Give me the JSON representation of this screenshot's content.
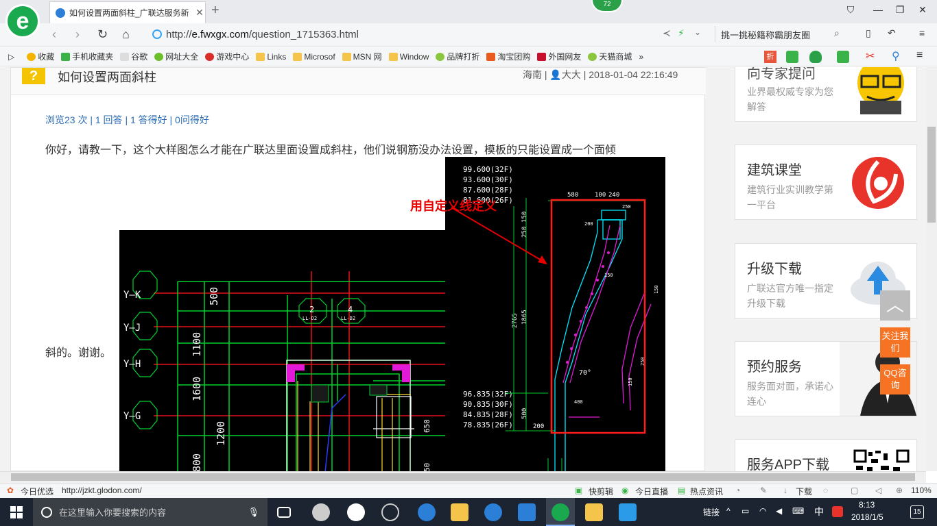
{
  "browser": {
    "tab_title": "如何设置两面斜柱_广联达服务新",
    "badge": "72",
    "url_scheme": "http://",
    "url_domain": "e.fwxgx.com",
    "url_path": "/question_1715363.html",
    "search_text": "挑一挑秘籍称霸朋友圈"
  },
  "bookmarks": [
    "收藏",
    "手机收藏夹",
    "谷歌",
    "网址大全",
    "游戏中心",
    "Links",
    "Microsof",
    "MSN 网",
    "Window",
    "品牌打折",
    "淘宝团购",
    "外国网友",
    "天猫商城"
  ],
  "question": {
    "title": "如何设置两面斜柱",
    "meta_region": "海南",
    "meta_user": "大大",
    "meta_time": "2018-01-04 22:16:49",
    "stats": "浏览23 次 | 1 回答 | 1 答得好 | 0问得好",
    "body": "你好，请教一下，这个大样图怎么才能在广联达里面设置成斜柱，他们说钢筋没办法设置，模板的只能设置成一个面倾",
    "body_end": "斜的。谢谢。"
  },
  "cad_left": {
    "axis_labels": [
      "Y—K",
      "Y—J",
      "Y—H",
      "Y—G"
    ],
    "dims": [
      "500",
      "1100",
      "1600",
      "1200",
      "800"
    ],
    "circles": [
      "2",
      "4"
    ],
    "circle_sub": [
      "LL-D2",
      "LL-D2"
    ],
    "right_dim": "650",
    "bottom_dim": "50"
  },
  "cad_right": {
    "annotation": "用自定义线定义",
    "elev_top": [
      "99.600(32F)",
      "93.600(30F)",
      "87.600(28F)",
      "81.600(26F)"
    ],
    "elev_bottom": [
      "96.835(32F)",
      "90.835(30F)",
      "84.835(28F)",
      "78.835(26F)"
    ],
    "top_dims": [
      "580",
      "100",
      "240"
    ],
    "side_dims": [
      "150",
      "250",
      "2765",
      "1865",
      "500",
      "200"
    ],
    "angle": "70°",
    "small_labels": [
      "250",
      "200",
      "150",
      "150",
      "150",
      "250",
      "400"
    ]
  },
  "sidebar": [
    {
      "title": "向专家提问",
      "desc": "业界最权威专家为您解答"
    },
    {
      "title": "建筑课堂",
      "desc": "建筑行业实训教学第一平台"
    },
    {
      "title": "升级下载",
      "desc": "广联达官方唯一指定升级下载"
    },
    {
      "title": "预约服务",
      "desc": "服务面对面，承诺心连心"
    },
    {
      "title": "服务APP下载",
      "desc": ""
    }
  ],
  "float": {
    "follow": "关注我们",
    "qq": "QQ咨询"
  },
  "status": {
    "left_label": "今日优选",
    "hover_url": "http://jzkt.glodon.com/",
    "items": [
      "快剪辑",
      "今日直播",
      "热点资讯",
      "下载"
    ],
    "zoom": "110%"
  },
  "taskbar": {
    "search_placeholder": "在这里输入你要搜索的内容",
    "tray_link": "链接",
    "ime": "中",
    "time": "8:13",
    "date": "2018/1/5",
    "notif": "15"
  }
}
